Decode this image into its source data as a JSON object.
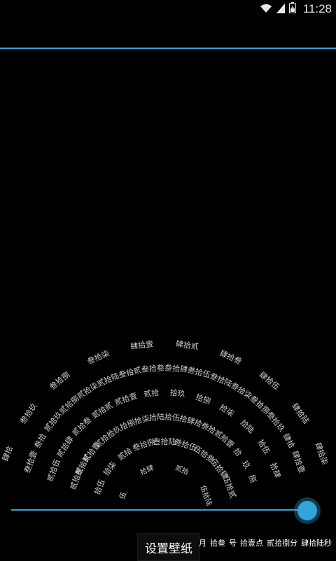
{
  "status": {
    "time": "11:28",
    "icons": [
      "wifi-icon",
      "signal-icon",
      "battery-icon"
    ]
  },
  "accent": "#33a3d8",
  "clock": {
    "rings": [
      {
        "name": "seconds",
        "labels": [
          "伍",
          "拾肆",
          "贰拾",
          "伍拾陆"
        ]
      },
      {
        "name": "minutes",
        "labels": [
          "拾伍",
          "拾柒",
          "贰拾",
          "叁拾捌",
          "叁拾陆",
          "叁拾伍",
          "伍拾叁",
          "伍拾肆",
          "伍拾贰"
        ]
      },
      {
        "name": "hours",
        "labels": [
          "贰拾叁",
          "贰拾贰",
          "贰拾壹",
          "贰拾",
          "拾玖",
          "拾捌",
          "拾柒",
          "拾陆",
          "拾伍",
          "拾肆",
          "拾叁",
          "拾贰",
          "拾壹",
          "拾",
          "玖",
          "捌"
        ]
      },
      {
        "name": "days",
        "labels": [
          "贰拾伍",
          "贰拾肆",
          "贰拾叁",
          "贰拾贰",
          "贰拾壹",
          "贰拾",
          "拾玖",
          "拾捌",
          "拾柒",
          "拾陆",
          "拾伍",
          "拾肆"
        ]
      },
      {
        "name": "outer",
        "labels": [
          "叁拾壹",
          "叁拾",
          "贰拾玖",
          "贰拾捌",
          "贰拾柒",
          "贰拾陆",
          "叁拾贰",
          "叁拾叁",
          "叁拾肆",
          "叁拾伍",
          "叁拾陆",
          "叁拾柒",
          "叁拾捌",
          "叁拾玖",
          "肆拾",
          "肆拾壹"
        ]
      },
      {
        "name": "right-column",
        "labels": [
          "肆拾",
          "叁拾玖",
          "叁拾捌",
          "叁拾柒",
          "肆拾壹",
          "肆拾贰",
          "肆拾叁",
          "肆拾伍",
          "肆拾陆",
          "肆拾柒"
        ]
      }
    ],
    "readout": {
      "month": "月",
      "day": "拾叁",
      "date_word": "号",
      "hour": "拾壹点",
      "minute": "贰拾捌分",
      "second": "肆拾陆秒"
    }
  },
  "slider": {
    "value": 0.97
  },
  "set_wallpaper_label": "设置壁纸"
}
